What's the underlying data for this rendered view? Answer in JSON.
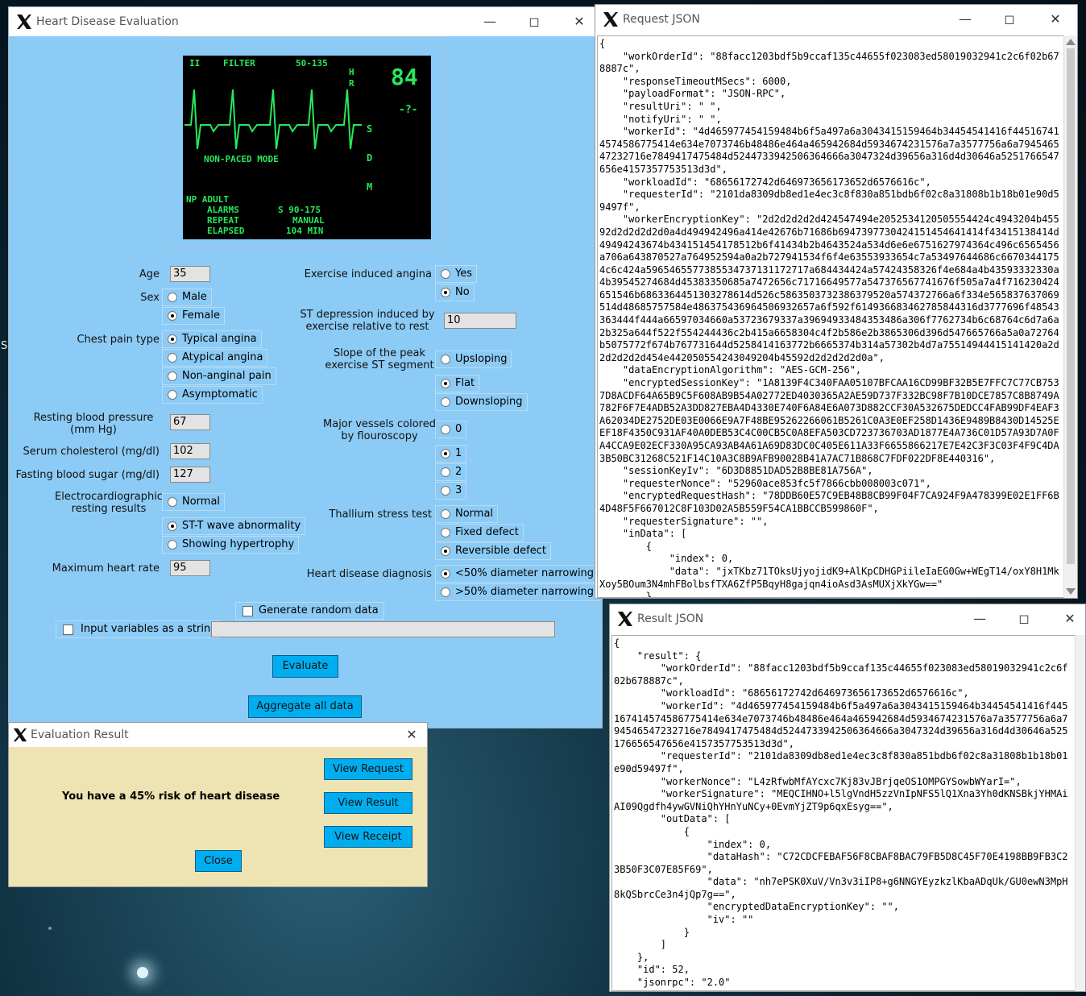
{
  "heart_window": {
    "title": "Heart Disease Evaluation",
    "ecg": {
      "lead": "II",
      "filter": "FILTER",
      "range": "50-135",
      "hr_label_letters": [
        "H",
        "R"
      ],
      "hr_value": "84",
      "side_code": "-?-",
      "mode": "NON-PACED MODE",
      "np_label": "NP ADULT",
      "alarms_label": "ALARMS",
      "alarms_value": "S 90-175",
      "repeat_label": "REPEAT",
      "repeat_value": "MANUAL",
      "elapsed_label": "ELAPSED",
      "elapsed_value": "104 MIN"
    },
    "age": {
      "label": "Age",
      "value": "35"
    },
    "sex": {
      "label": "Sex",
      "options": [
        "Male",
        "Female"
      ],
      "selected": "Female"
    },
    "chest_pain": {
      "label": "Chest pain type",
      "options": [
        "Typical angina",
        "Atypical angina",
        "Non-anginal pain",
        "Asymptomatic"
      ],
      "selected": "Typical angina"
    },
    "resting_bp": {
      "label": "Resting blood pressure\n(mm Hg)",
      "value": "67"
    },
    "cholesterol": {
      "label": "Serum cholesterol (mg/dl)",
      "value": "102"
    },
    "fasting_sugar": {
      "label": "Fasting blood sugar (mg/dl)",
      "value": "127"
    },
    "ecg_results": {
      "label": "Electrocardiographic\nresting results",
      "options": [
        "Normal",
        "ST-T wave abnormality",
        "Showing hypertrophy"
      ],
      "selected": "ST-T wave abnormality"
    },
    "max_hr": {
      "label": "Maximum heart rate",
      "value": "95"
    },
    "exercise_angina": {
      "label": "Exercise induced angina",
      "options": [
        "Yes",
        "No"
      ],
      "selected": "No"
    },
    "st_depression": {
      "label": "ST depression induced by\nexercise relative to rest",
      "value": "10"
    },
    "slope": {
      "label": "Slope of the peak\nexercise ST segment",
      "options": [
        "Upsloping",
        "Flat",
        "Downsloping"
      ],
      "selected": "Flat"
    },
    "vessels": {
      "label": "Major vessels colored\nby flouroscopy",
      "options": [
        "0",
        "1",
        "2",
        "3"
      ],
      "selected": "1"
    },
    "thallium": {
      "label": "Thallium stress test",
      "options": [
        "Normal",
        "Fixed defect",
        "Reversible defect"
      ],
      "selected": "Reversible defect"
    },
    "diagnosis": {
      "label": "Heart disease diagnosis",
      "options": [
        "<50% diameter narrowing",
        ">50% diameter narrowing"
      ],
      "selected": "<50% diameter narrowing"
    },
    "generate_random": {
      "label": "Generate random data",
      "checked": false
    },
    "input_string": {
      "label": "Input variables as a string",
      "checked": false,
      "value": ""
    },
    "evaluate_label": "Evaluate",
    "aggregate_label": "Aggregate all data"
  },
  "eval_window": {
    "title": "Evaluation Result",
    "message": "You have a 45% risk of heart disease",
    "view_request": "View Request",
    "view_result": "View Result",
    "view_receipt": "View Receipt",
    "close": "Close"
  },
  "request_window": {
    "title": "Request JSON",
    "content": "{\n    \"workOrderId\": \"88facc1203bdf5b9ccaf135c44655f023083ed58019032941c2c6f02b678887c\",\n    \"responseTimeoutMSecs\": 6000,\n    \"payloadFormat\": \"JSON-RPC\",\n    \"resultUri\": \" \",\n    \"notifyUri\": \" \",\n    \"workerId\": \"4d465977454159484b6f5a497a6a3043415159464b34454541416f445167414574586775414e634e7073746b48486e464a465942684d5934674231576a7a3577756a6a794546547232716e7849417475484d5244733942506364666a3047324d39656a316d4d30646a5251766547656e4157357753513d3d\",\n    \"workloadId\": \"68656172742d646973656173652d6576616c\",\n    \"requesterId\": \"2101da8309db8ed1e4ec3c8f830a851bdb6f02c8a31808b1b18b01e90d59497f\",\n    \"workerEncryptionKey\": \"2d2d2d2d2d424547494e2052534120505554424c4943204b45592d2d2d2d2d0a4d494942496a414e42676b71686b6947397730424151454641414f43415138414d49494243674b434151454178512b6f41434b2b4643524a534d6e6e6751627974364c496c6565456a706a643870527a764952594a0a2b727941534f6f4e63553933654c7a53497644686c66703441754c6c424a5965465577385534737131172717a684434424a57424358326f4e684a4b43593332330a4b39545274684d45383350685a7472656c71716649577a547376567741676f505a7a4f716230424651546b6863364451303278614d526c5863503732386379520a574372766a6f334e565837637069514d48685757584e486375436964506932657a6f592f614936683462785844316d3777696f48543363444f444a66597034660a53723679337a39694933484353486a306f7762734b6c68764c6d7a6a2b325a644f522f554244436c2b415a6658304c4f2b586e2b3865306d396d547665766a5a0a72764b5075772f674b767731644d5258414163772b6665374b314a57302b4d7a75514944415141420a2d2d2d2d2d454e442050554243049204b45592d2d2d2d2d0a\",\n    \"dataEncryptionAlgorithm\": \"AES-GCM-256\",\n    \"encryptedSessionKey\": \"1A8139F4C340FAA05107BFCAA16CD99BF32B5E7FFC7C77CB7537D8ACDF64A65B9C5F608AB9B54A02772ED4030365A2AE59D737F332BC98F7B10DCE7857C8B8749A782F6F7E4ADB52A3DD827EBA4D4330E740F6A84E6A073D882CCF30A532675DEDCC4FAB99DF4EAF3A62034DE2752DE03E0066E9A7F48BE95262266061B5261C0A3E0EF258D1436E9489B8430D14525EEF18F4350C931AF40A0DEB53C4C00CB5C0A8EFA503CD723736703AD1877E4A736C01D57A93D7A0FA4CCA9E02ECF330A95CA93AB4A61A69D83DC0C405E611A33F6655866217E7E42C3F3C03F4F9C4DA3B50BC31268C521F14C10A3C8B9AFB90028B41A7AC71B868C7FDF022DF8E440316\",\n    \"sessionKeyIv\": \"6D3D8851DAD52B8BE81A756A\",\n    \"requesterNonce\": \"52960ace853fc5f7866cbb008003c071\",\n    \"encryptedRequestHash\": \"78DDB60E57C9EB48B8CB99F04F7CA924F9A478399E02E1FF6B4D48F5F667012C8F103D02A5B559F54CA1BBCCB599860F\",\n    \"requesterSignature\": \"\",\n    \"inData\": [\n        {\n            \"index\": 0,\n            \"data\": \"jxTKbz71TOksUjyojidK9+AlKpCDHGPiileIaEG0Gw+WEgT14/oxY8H1MkXoy5BOum3N4mhFBolbsfTXA6ZfP5BqyH8gajqn4ioAsd3AsMUXjXkYGw==\"\n        }\n    ]\n}"
  },
  "result_window": {
    "title": "Result JSON",
    "content": "{\n    \"result\": {\n        \"workOrderId\": \"88facc1203bdf5b9ccaf135c44655f023083ed58019032941c2c6f02b678887c\",\n        \"workloadId\": \"68656172742d646973656173652d6576616c\",\n        \"workerId\": \"4d465977454159484b6f5a497a6a3043415159464b34454541416f445167414574586775414e634e7073746b48486e464a465942684d5934674231576a7a3577756a6a794546547232716e7849417475484d5244733942506364666a3047324d39656a316d4d30646a525176656547656e4157357753513d3d\",\n        \"requesterId\": \"2101da8309db8ed1e4ec3c8f830a851bdb6f02c8a31808b1b18b01e90d59497f\",\n        \"workerNonce\": \"L4zRfwbMfAYcxc7Kj83vJBrjqeOS1OMPGYSowbWYarI=\",\n        \"workerSignature\": \"MEQCIHNO+l5lgVndH5zzVnIpNFS5lQ1Xna3Yh0dKNSBkjYHMAiAI09Qgdfh4ywGVNiQhYHnYuNCy+0EvmYjZT9p6qxEsyg==\",\n        \"outData\": [\n            {\n                \"index\": 0,\n                \"dataHash\": \"C72CDCFEBAF56F8CBAF8BAC79FB5D8C45F70E4198BB9FB3C23B50F3C07E85F69\",\n                \"data\": \"nh7ePSK0XuV/Vn3v3iIP8+g6NNGYEyzkzlKbaADqUk/GU0ewN3MpH8kQSbrcCe3n4jQp7g==\",\n                \"encryptedDataEncryptionKey\": \"\",\n                \"iv\": \"\"\n            }\n        ]\n    },\n    \"id\": 52,\n    \"jsonrpc\": \"2.0\"\n}"
  },
  "desktop": {
    "edge_glyph": "S"
  },
  "colors": {
    "form_bg": "#8ccbf5",
    "button": "#00aef0",
    "dialog_bg": "#eee3b2",
    "ecg_green": "#27e85a"
  }
}
